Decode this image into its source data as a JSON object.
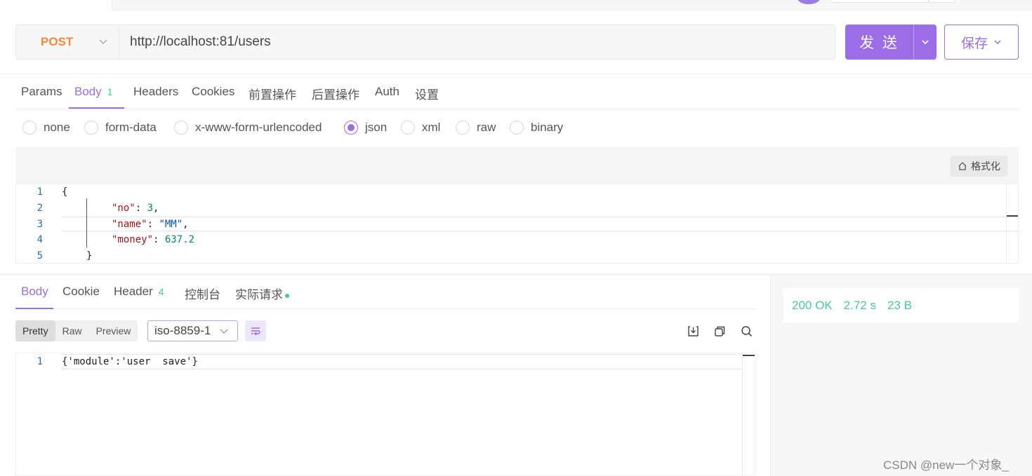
{
  "request": {
    "method": "POST",
    "url": "http://localhost:81/users",
    "send_label": "发 送",
    "save_label": "保存"
  },
  "request_tabs": [
    {
      "label": "Params"
    },
    {
      "label": "Body",
      "count": "1"
    },
    {
      "label": "Headers"
    },
    {
      "label": "Cookies"
    },
    {
      "label": "前置操作"
    },
    {
      "label": "后置操作"
    },
    {
      "label": "Auth"
    },
    {
      "label": "设置"
    }
  ],
  "body_types": [
    {
      "label": "none",
      "selected": false
    },
    {
      "label": "form-data",
      "selected": false
    },
    {
      "label": "x-www-form-urlencoded",
      "selected": false
    },
    {
      "label": "json",
      "selected": true
    },
    {
      "label": "xml",
      "selected": false
    },
    {
      "label": "raw",
      "selected": false
    },
    {
      "label": "binary",
      "selected": false
    }
  ],
  "editor": {
    "format_label": "格式化",
    "line_numbers": [
      "1",
      "2",
      "3",
      "4",
      "5"
    ],
    "lines": {
      "l1": "{",
      "l2_key": "\"no\"",
      "l2_colon": ": ",
      "l2_val": "3",
      "l2_end": ",",
      "l3_key": "\"name\"",
      "l3_colon": ": ",
      "l3_val": "\"MM\"",
      "l3_end": ",",
      "l4_key": "\"money\"",
      "l4_colon": ": ",
      "l4_val": "637.2",
      "l5": "}"
    }
  },
  "response_tabs": [
    {
      "label": "Body"
    },
    {
      "label": "Cookie"
    },
    {
      "label": "Header",
      "count": "4"
    },
    {
      "label": "控制台"
    },
    {
      "label": "实际请求"
    }
  ],
  "response_view": {
    "modes": [
      "Pretty",
      "Raw",
      "Preview"
    ],
    "active_mode": "Pretty",
    "encoding": "iso-8859-1",
    "line_numbers": [
      "1"
    ],
    "content": "{'module':'user  save'}"
  },
  "status": {
    "code": "200 OK",
    "time": "2.72 s",
    "size": "23 B"
  },
  "watermark": "CSDN @new一个对象_",
  "icons": [
    "chevron-down-icon",
    "format-icon",
    "wrap-icon",
    "download-icon",
    "copy-icon",
    "search-icon"
  ],
  "colors": {
    "accent": "#9b6ee8",
    "method": "#f08a3c",
    "success": "#4cc79a"
  }
}
